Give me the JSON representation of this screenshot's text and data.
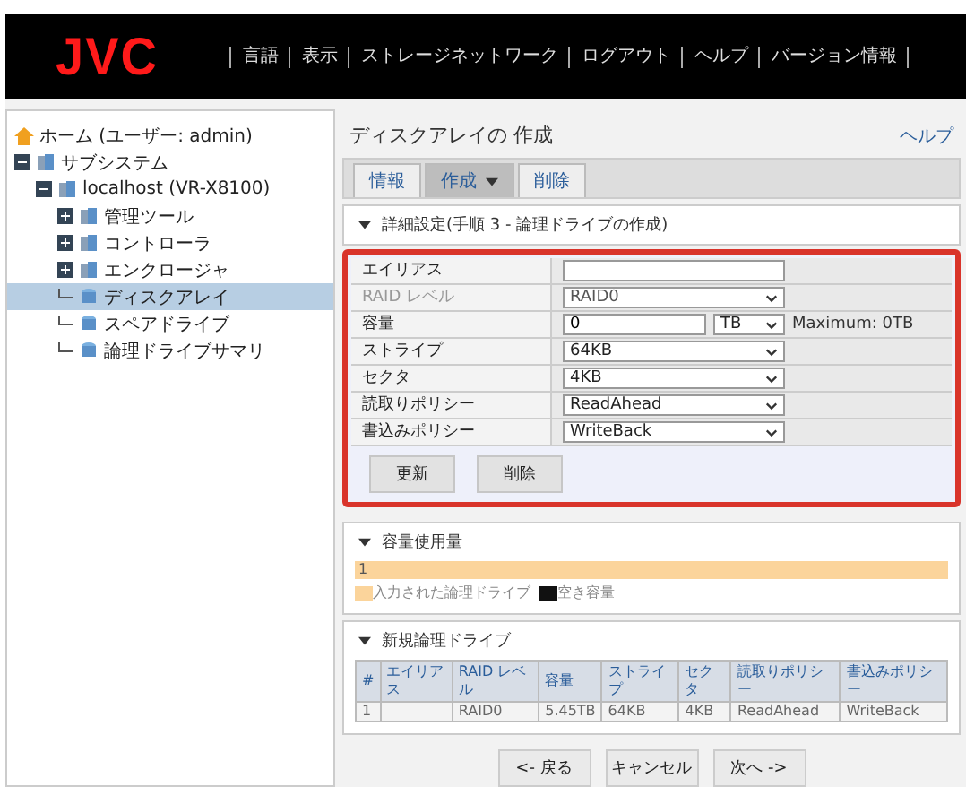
{
  "header": {
    "logo": "JVC",
    "nav": [
      "言語",
      "表示",
      "ストレージネットワーク",
      "ログアウト",
      "ヘルプ",
      "バージョン情報"
    ]
  },
  "tree": [
    {
      "label": "ホーム (ユーザー: admin)",
      "kind": "home",
      "selected": false
    },
    {
      "label": "サブシステム",
      "kind": "folder",
      "expanded": true,
      "selected": false,
      "children": [
        {
          "label": "localhost (VR-X8100)",
          "kind": "folder",
          "expanded": true,
          "selected": false,
          "children": [
            {
              "label": "管理ツール",
              "kind": "folder",
              "expanded": false,
              "selected": false
            },
            {
              "label": "コントローラ",
              "kind": "folder",
              "expanded": false,
              "selected": false
            },
            {
              "label": "エンクロージャ",
              "kind": "folder",
              "expanded": false,
              "selected": false
            },
            {
              "label": "ディスクアレイ",
              "kind": "leaf",
              "selected": true
            },
            {
              "label": "スペアドライブ",
              "kind": "leaf",
              "selected": false
            },
            {
              "label": "論理ドライブサマリ",
              "kind": "leaf",
              "selected": false
            }
          ]
        }
      ]
    }
  ],
  "page": {
    "title": "ディスクアレイの 作成",
    "help": "ヘルプ"
  },
  "tabs": [
    {
      "label": "情報",
      "selected": false,
      "dropdown": false
    },
    {
      "label": "作成",
      "selected": true,
      "dropdown": true
    },
    {
      "label": "削除",
      "selected": false,
      "dropdown": false
    }
  ],
  "settings": {
    "title": "詳細設定(手順 3 - 論理ドライブの作成)",
    "rows": [
      {
        "label": "エイリアス",
        "kind": "text",
        "value": "",
        "disabled": false
      },
      {
        "label": "RAID レベル",
        "kind": "select",
        "value": "RAID0",
        "disabled": true
      },
      {
        "label": "容量",
        "kind": "size",
        "value": "0",
        "unit": "TB",
        "note": "Maximum: 0TB",
        "disabled": false
      },
      {
        "label": "ストライプ",
        "kind": "select",
        "value": "64KB",
        "disabled": false
      },
      {
        "label": "セクタ",
        "kind": "select",
        "value": "4KB",
        "disabled": false
      },
      {
        "label": "読取りポリシー",
        "kind": "select",
        "value": "ReadAhead",
        "disabled": false
      },
      {
        "label": "書込みポリシー",
        "kind": "select",
        "value": "WriteBack",
        "disabled": false
      }
    ],
    "buttons": [
      "更新",
      "削除"
    ]
  },
  "usage": {
    "title": "容量使用量",
    "bar_label": "1",
    "level": 1,
    "legend": [
      {
        "label": "入力された論理ドライブ",
        "color": "#fbd49b"
      },
      {
        "label": "空き容量",
        "color": "#111111"
      }
    ]
  },
  "drives": {
    "title": "新規論理ドライブ",
    "columns": [
      "#",
      "エイリアス",
      "RAID レベル",
      "容量",
      "ストライプ",
      "セクタ",
      "読取りポリシー",
      "書込みポリシー"
    ],
    "rows": [
      [
        "1",
        "",
        "RAID0",
        "5.45TB",
        "64KB",
        "4KB",
        "ReadAhead",
        "WriteBack"
      ]
    ]
  },
  "nav_buttons": [
    "<- 戻る",
    "キャンセル",
    "次へ ->"
  ]
}
